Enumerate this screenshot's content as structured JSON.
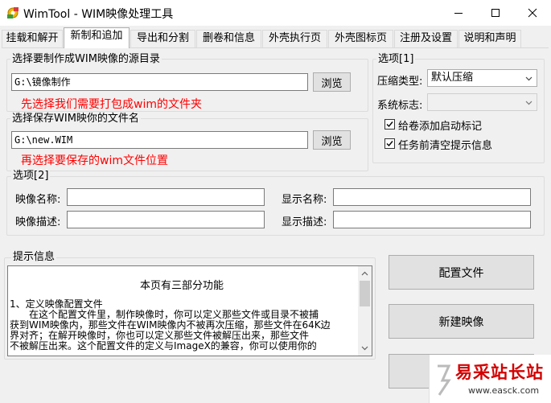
{
  "window": {
    "title": "WimTool - WIM映像处理工具",
    "icon": "app-gear-icon",
    "controls": [
      "minimize-icon",
      "maximize-icon",
      "close-icon"
    ]
  },
  "tabs": [
    {
      "label": "挂载和解开"
    },
    {
      "label": "新制和追加"
    },
    {
      "label": "导出和分割"
    },
    {
      "label": "删卷和信息"
    },
    {
      "label": "外壳执行页"
    },
    {
      "label": "外壳图标页"
    },
    {
      "label": "注册及设置"
    },
    {
      "label": "说明和声明"
    }
  ],
  "active_tab": "新制和追加",
  "source_group": {
    "title": "选择要制作成WIM映像的源目录",
    "value": "G:\\镜像制作",
    "browse_label": "浏览",
    "hint": "先选择我们需要打包成wim的文件夹"
  },
  "target_group": {
    "title": "选择保存WIM映你的文件名",
    "value": "G:\\new.WIM",
    "browse_label": "浏览",
    "hint": "再选择要保存的wim文件位置"
  },
  "options1": {
    "title": "选项[1]",
    "compression_label": "压缩类型:",
    "compression_value": "默认压缩",
    "system_flag_label": "系统标志:",
    "system_flag_value": "",
    "checkboxes": [
      {
        "label": "给卷添加启动标记",
        "checked": true
      },
      {
        "label": "任务前清空提示信息",
        "checked": true
      }
    ]
  },
  "options2": {
    "title": "选项[2]",
    "image_name_label": "映像名称:",
    "image_name_value": "",
    "display_name_label": "显示名称:",
    "display_name_value": "",
    "image_desc_label": "映像描述:",
    "image_desc_value": "",
    "display_desc_label": "显示描述:",
    "display_desc_value": ""
  },
  "info": {
    "title": "提示信息",
    "heading": "本页有三部分功能",
    "lines": [
      "1、定义映像配置文件",
      "　　在这个配置文件里，制作映像时，你可以定义那些文件或目录不被捕",
      "获到WIM映像内，那些文件在WIM映像内不被再次压缩，那些文件在64K边",
      "界对齐；在解开映像时，你也可以定义那些文件被解压出来，那些文件",
      "不被解压出来。这个配置文件的定义与ImageX的兼容，你可以使用你的"
    ]
  },
  "actions": {
    "config_label": "配置文件",
    "new_image_label": "新建映像",
    "append_label": "追"
  },
  "watermark": {
    "title": "易采站长站",
    "url": "www.easck.com"
  },
  "colors": {
    "hint_red": "#ff0000",
    "watermark_red": "#d40000"
  }
}
